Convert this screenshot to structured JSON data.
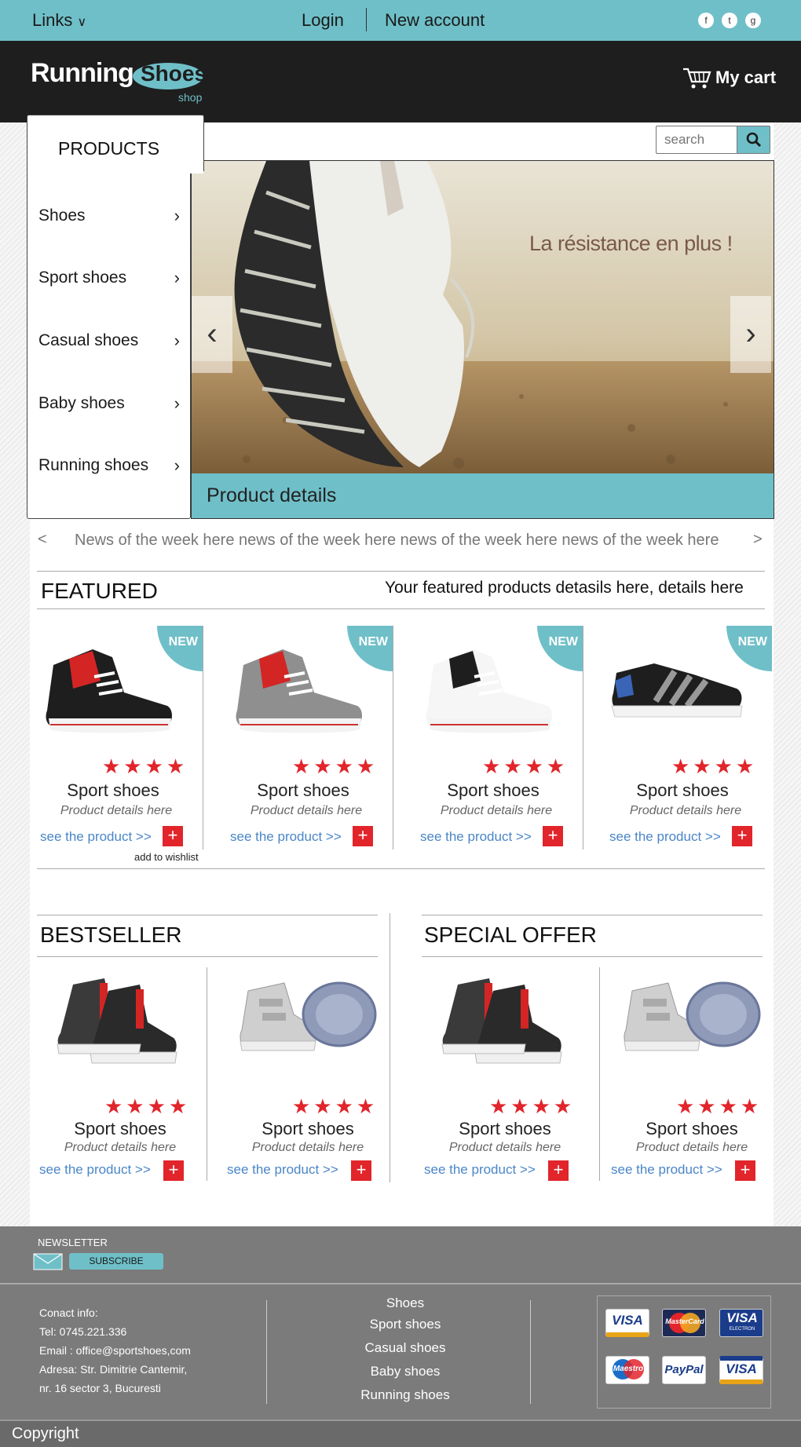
{
  "topbar": {
    "links_label": "Links",
    "login_label": "Login",
    "new_account_label": "New account",
    "social": [
      "f",
      "t",
      "g"
    ]
  },
  "header": {
    "logo_word1": "Running",
    "logo_word2": "Shoes",
    "logo_word3": "shop",
    "cart_label": "My cart"
  },
  "products_menu": {
    "title": "PRODUCTS",
    "items": [
      {
        "label": "Shoes"
      },
      {
        "label": "Sport shoes"
      },
      {
        "label": "Casual shoes"
      },
      {
        "label": "Baby shoes"
      },
      {
        "label": "Running shoes"
      }
    ]
  },
  "search": {
    "placeholder": "search"
  },
  "slider": {
    "caption": "La résistance en plus !",
    "details_label": "Product details"
  },
  "news": {
    "text": "News of the week here news of the week here news of the week here news of the week here"
  },
  "featured": {
    "title": "FEATURED",
    "subtitle": "Your featured products detasils here, details here",
    "badge": "NEW",
    "wishlist_label": "add to wishlist",
    "items": [
      {
        "name": "Sport shoes",
        "sub": "Product details here",
        "link": "see the product  >>",
        "rating": 4
      },
      {
        "name": "Sport shoes",
        "sub": "Product details here",
        "link": "see the product  >>",
        "rating": 4
      },
      {
        "name": "Sport shoes",
        "sub": "Product details here",
        "link": "see the product  >>",
        "rating": 4
      },
      {
        "name": "Sport shoes",
        "sub": "Product details here",
        "link": "see the product  >>",
        "rating": 4
      }
    ]
  },
  "bestseller": {
    "title": "BESTSELLER",
    "items": [
      {
        "name": "Sport shoes",
        "sub": "Product details here",
        "link": "see the product  >>",
        "rating": 4
      },
      {
        "name": "Sport shoes",
        "sub": "Product details here",
        "link": "see the product  >>",
        "rating": 4
      }
    ]
  },
  "special_offer": {
    "title": "SPECIAL OFFER",
    "items": [
      {
        "name": "Sport shoes",
        "sub": "Product details here",
        "link": "see the product  >>",
        "rating": 4
      },
      {
        "name": "Sport shoes",
        "sub": "Product details here",
        "link": "see the product  >>",
        "rating": 4
      }
    ]
  },
  "newsletter": {
    "title": "NEWSLETTER",
    "subscribe_label": "SUBSCRIBE"
  },
  "footer": {
    "contact": [
      "Conact info:",
      "Tel: 0745.221.336",
      "Email : office@sportshoes,com",
      "Adresa: Str. Dimitrie Cantemir,",
      "nr. 16 sector 3, Bucuresti"
    ],
    "links": [
      "Shoes",
      "Sport shoes",
      "Casual shoes",
      "Baby shoes",
      "Running shoes"
    ],
    "payment": [
      "VISA",
      "MasterCard",
      "VISA",
      "Maestro",
      "PayPal",
      "VISA"
    ],
    "payment_sub": "ELECTRON",
    "copyright": "Copyright"
  },
  "colors": {
    "accent": "#6fbfc8",
    "dark": "#1e1e1e",
    "red": "#e1252b",
    "link": "#4a86c8"
  }
}
